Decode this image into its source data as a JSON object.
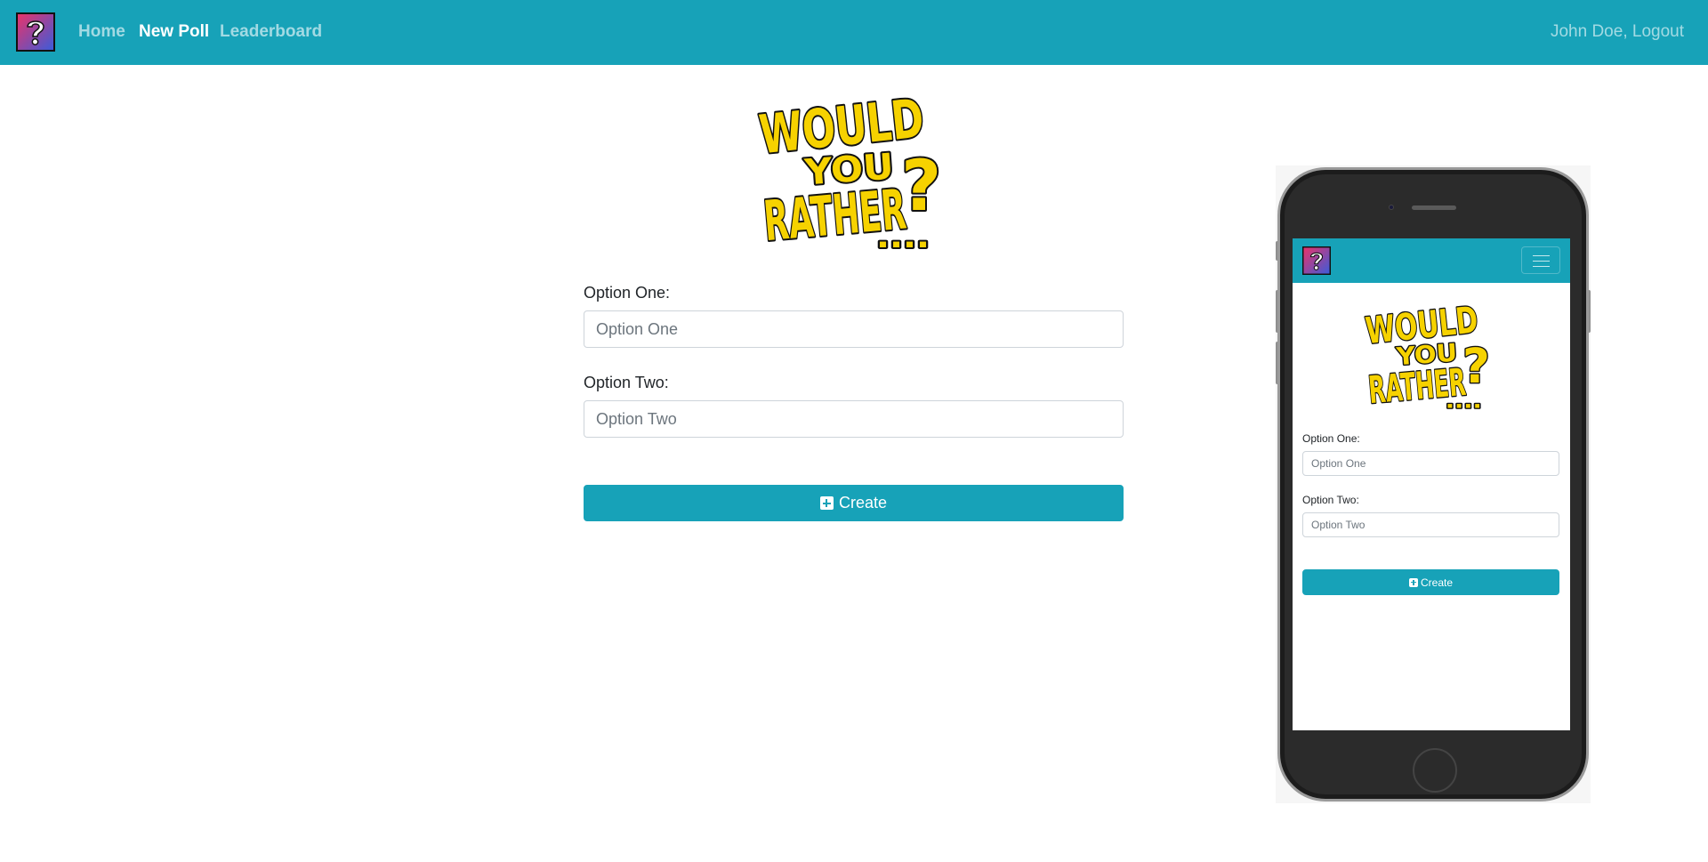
{
  "navbar": {
    "brand_icon": "question-mark-logo-icon",
    "links": [
      {
        "label": "Home",
        "active": false
      },
      {
        "label": "New Poll",
        "active": true
      },
      {
        "label": "Leaderboard",
        "active": false
      }
    ],
    "user_text": "John Doe, Logout"
  },
  "logo": {
    "lines": [
      "WOULD",
      "YOU",
      "RATHER",
      "?...."
    ]
  },
  "form": {
    "option_one_label": "Option One:",
    "option_one_placeholder": "Option One",
    "option_one_value": "",
    "option_two_label": "Option Two:",
    "option_two_placeholder": "Option Two",
    "option_two_value": "",
    "create_label": "Create",
    "create_icon": "plus-square-icon"
  },
  "mobile_preview": {
    "menu_icon": "hamburger-menu-icon",
    "option_one_label": "Option One:",
    "option_one_placeholder": "Option One",
    "option_two_label": "Option Two:",
    "option_two_placeholder": "Option Two",
    "create_label": "Create"
  },
  "colors": {
    "primary": "#17a2b8",
    "logo_yellow": "#f6d200",
    "logo_outline": "#111111",
    "brand_pink": "#e8336a",
    "brand_blue": "#3d5bd9"
  }
}
